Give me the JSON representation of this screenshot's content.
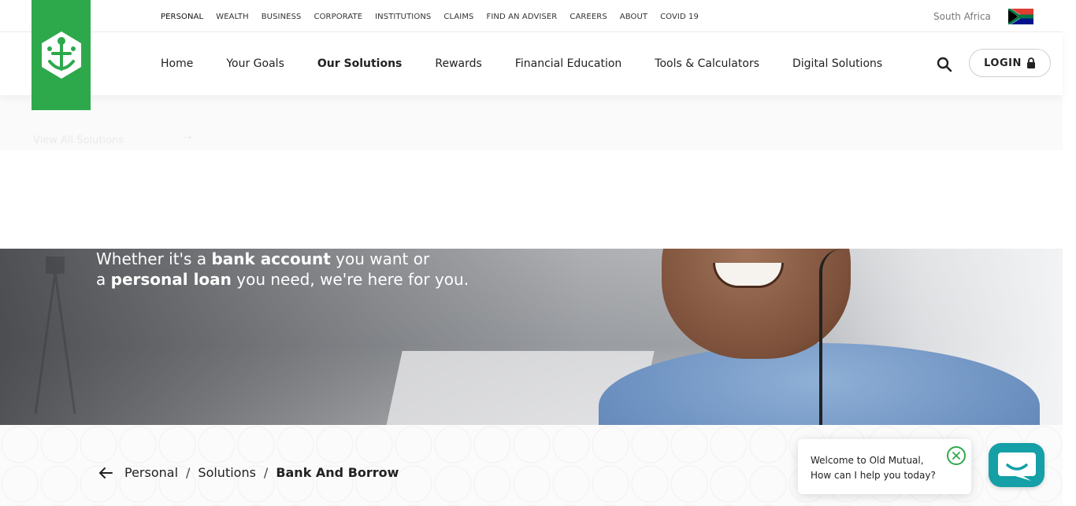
{
  "utility_nav": {
    "items": [
      {
        "label": "PERSONAL",
        "active": true
      },
      {
        "label": "WEALTH"
      },
      {
        "label": "BUSINESS"
      },
      {
        "label": "CORPORATE"
      },
      {
        "label": "INSTITUTIONS"
      },
      {
        "label": "CLAIMS"
      },
      {
        "label": "FIND AN ADVISER"
      },
      {
        "label": "CAREERS"
      },
      {
        "label": "ABOUT"
      },
      {
        "label": "COVID 19"
      }
    ],
    "region": "South Africa",
    "flag_icon": "south-africa-flag-icon"
  },
  "logo": {
    "icon": "old-mutual-logo-icon",
    "color": "#2da94b"
  },
  "main_nav": {
    "items": [
      {
        "label": "Home"
      },
      {
        "label": "Your Goals"
      },
      {
        "label": "Our Solutions",
        "active": true
      },
      {
        "label": "Rewards"
      },
      {
        "label": "Financial Education"
      },
      {
        "label": "Tools & Calculators"
      },
      {
        "label": "Digital Solutions"
      }
    ],
    "search_icon": "search-icon",
    "login_label": "LOGIN",
    "lock_icon": "lock-icon"
  },
  "dropdown": {
    "view_all": "View All Solutions"
  },
  "hero": {
    "line1_pre": "Whether it's a ",
    "line1_bold": "bank account",
    "line1_post": " you want or",
    "line2_pre": "a ",
    "line2_bold": "personal loan",
    "line2_post": " you need, we're here for you."
  },
  "breadcrumb": {
    "back_icon": "arrow-left-icon",
    "items": [
      "Personal",
      "Solutions",
      "Bank And Borrow"
    ],
    "separator": "/"
  },
  "chat": {
    "line1": "Welcome to Old Mutual,",
    "line2": "How can I help you today?",
    "close_icon": "close-circle-icon",
    "launcher_icon": "chat-bubble-icon",
    "launcher_color": "#159fa7"
  }
}
